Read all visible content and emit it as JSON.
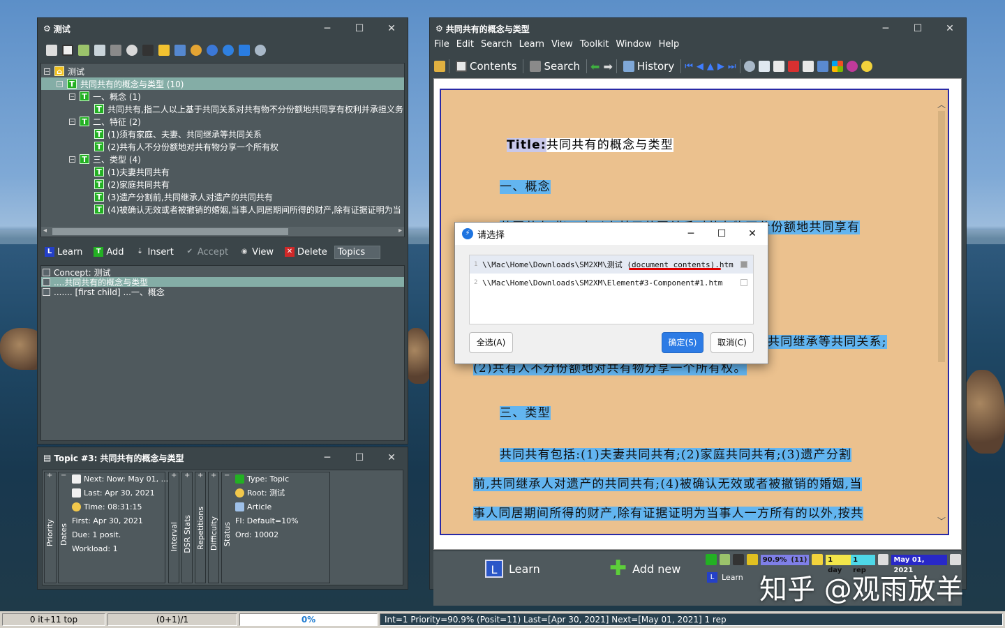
{
  "left_window": {
    "title": "测试",
    "tree": [
      {
        "label": "测试",
        "icon": "root"
      },
      {
        "label": "共同共有的概念与类型 (10)",
        "icon": "T"
      },
      {
        "label": "一、概念 (1)",
        "icon": "T"
      },
      {
        "label": "共同共有,指二人以上基于共同关系对共有物不分份额地共同享有权利并承担义务",
        "icon": "T"
      },
      {
        "label": "二、特征 (2)",
        "icon": "T"
      },
      {
        "label": "(1)须有家庭、夫妻、共同继承等共同关系",
        "icon": "T"
      },
      {
        "label": "(2)共有人不分份额地对共有物分享一个所有权",
        "icon": "T"
      },
      {
        "label": "三、类型 (4)",
        "icon": "T"
      },
      {
        "label": "(1)夫妻共同共有",
        "icon": "T"
      },
      {
        "label": "(2)家庭共同共有",
        "icon": "T"
      },
      {
        "label": "(3)遗产分割前,共同继承人对遗产的共同共有",
        "icon": "T"
      },
      {
        "label": "(4)被确认无效或者被撤销的婚姻,当事人同居期间所得的财产,除有证据证明为当",
        "icon": "T"
      }
    ],
    "buttons": {
      "learn": "Learn",
      "add": "Add",
      "insert": "Insert",
      "accept": "Accept",
      "view": "View",
      "delete": "Delete",
      "topics": "Topics"
    },
    "list": [
      "Concept: 测试",
      "....共同共有的概念与类型",
      "....... [first child] ...一、概念"
    ]
  },
  "topic_window": {
    "title": "Topic #3: 共同共有的概念与类型",
    "dates": {
      "next": "Next: Now: May 01, ...",
      "last": "Last: Apr 30, 2021",
      "time": "Time: 08:31:15",
      "first": "First: Apr 30, 2021",
      "due": "Due: 1 posit.",
      "workload": "Workload: 1"
    },
    "vlabels": {
      "priority": "Priority",
      "dates": "Dates",
      "interval": "Interval",
      "dsr": "DSR Stats",
      "repetitions": "Repetitions",
      "difficulty": "Difficulty",
      "status": "Status"
    },
    "status": {
      "type": "Type: Topic",
      "root": "Root: 测试",
      "article": "Article",
      "fi": "FI: Default=10%",
      "ord": "Ord: 10002"
    }
  },
  "right_window": {
    "title": "共同共有的概念与类型",
    "menu": [
      "File",
      "Edit",
      "Search",
      "Learn",
      "View",
      "Toolkit",
      "Window",
      "Help"
    ],
    "nav": {
      "contents": "Contents",
      "search": "Search",
      "history": "History"
    },
    "doc": {
      "title_label": "Title:",
      "title_value": "共同共有的概念与类型",
      "h1": "一、概念",
      "p1": "共同共有,指二人以上基于共同关系对共有物不分份额地共同享有",
      "p2a": "共同继承等共同关系;",
      "p2b": "(2)共有人不分份额地对共有物分享一个所有权。",
      "h3": "三、类型",
      "p3a": "共同共有包括:(1)夫妻共同共有;(2)家庭共同共有;(3)遗产分割",
      "p3b": "前,共同继承人对遗产的共同共有;(4)被确认无效或者被撤销的婚姻,当",
      "p3c": "事人同居期间所得的财产,除有证据证明为当事人一方所有的以外,按共"
    },
    "bottom": {
      "learn": "Learn",
      "add_new": "Add new",
      "priority_badge": "90.9%",
      "count_badge": "(11)",
      "interval_badge": "1 day",
      "rep_badge": "1 rep",
      "date_badge": "May 01, 2021",
      "learn_small": "Learn"
    }
  },
  "dialog": {
    "title": "请选择",
    "rows": [
      {
        "num": "1",
        "path": "\\\\Mac\\Home\\Downloads\\SM2XM\\测试 (document contents).htm"
      },
      {
        "num": "2",
        "path": "\\\\Mac\\Home\\Downloads\\SM2XM\\Element#3-Component#1.htm"
      }
    ],
    "select_all": "全选(A)",
    "ok": "确定(S)",
    "cancel": "取消(C)"
  },
  "statusbar": {
    "s1": "0 it+11 top",
    "s2": "(0+1)/1",
    "s3": "0%",
    "s4": "Int=1 Priority=90.9% (Posit=11) Last=[Apr 30, 2021] Next=[May 01, 2021] 1 rep"
  },
  "watermark": "知乎 @观雨放羊",
  "colors": {
    "accent_green": "#23b023",
    "highlight_blue": "#63b5f0",
    "doc_bg": "#ebc18e",
    "selection": "#84ada6"
  }
}
